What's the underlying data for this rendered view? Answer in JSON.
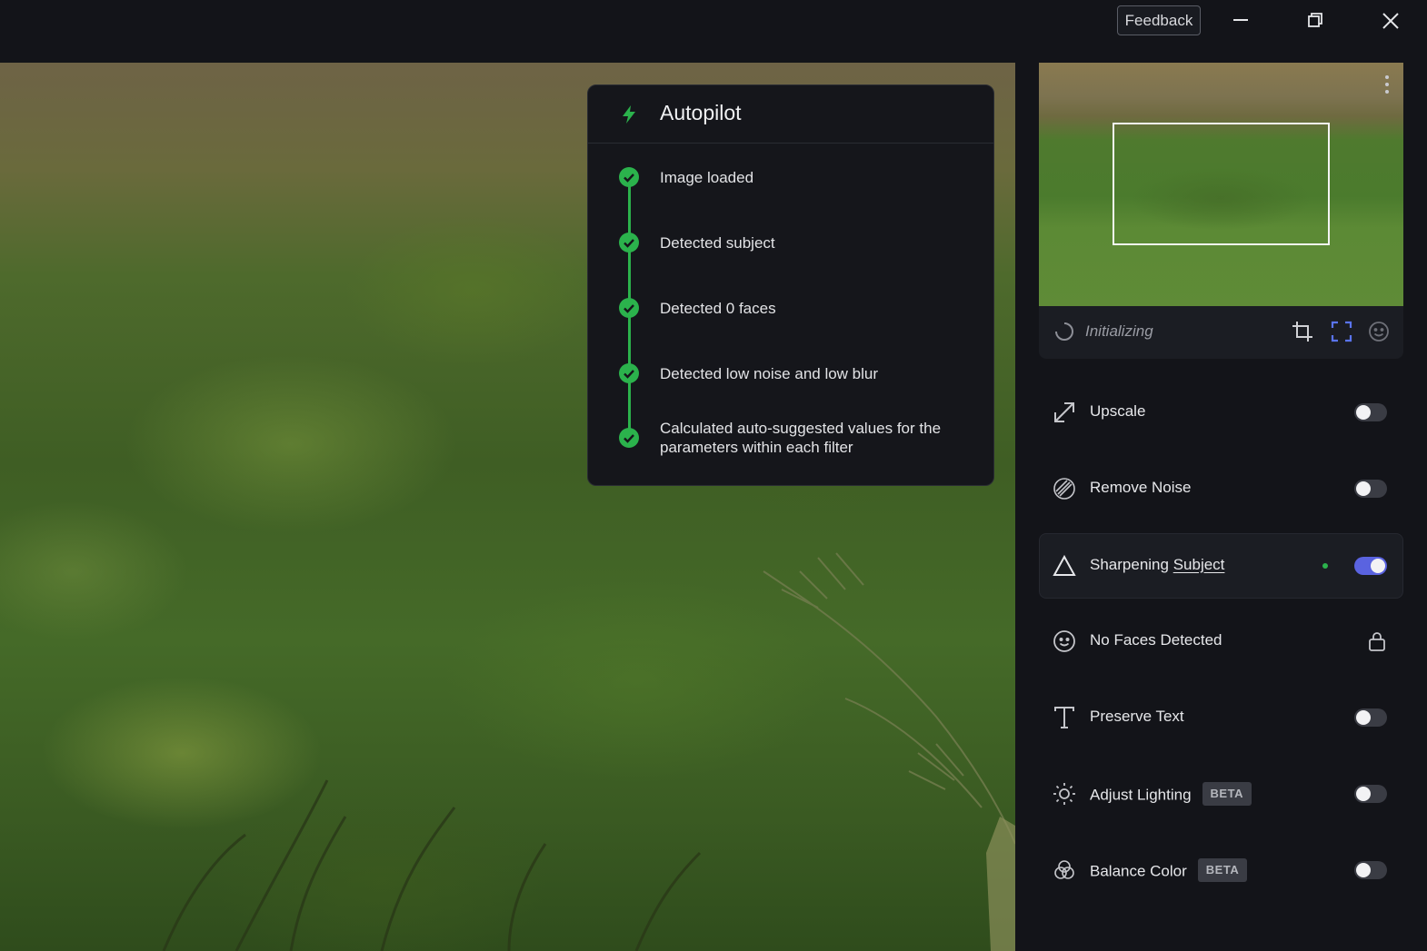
{
  "titlebar": {
    "feedback_label": "Feedback",
    "minimize_icon": "minimize-icon",
    "restore_icon": "restore-icon",
    "close_icon": "close-icon"
  },
  "autopilot": {
    "title": "Autopilot",
    "icon": "lightning-bolt-icon",
    "accent_color": "#2bb24c",
    "steps": [
      {
        "label": "Image loaded",
        "status": "done"
      },
      {
        "label": "Detected subject",
        "status": "done"
      },
      {
        "label": "Detected 0 faces",
        "status": "done"
      },
      {
        "label": "Detected low noise and low blur",
        "status": "done"
      },
      {
        "label": "Calculated auto-suggested values for the parameters within each filter",
        "status": "done"
      }
    ]
  },
  "navigator": {
    "status_text": "Initializing",
    "tools": [
      "crop-icon",
      "fit-to-screen-icon",
      "face-icon"
    ],
    "more_icon": "more-vertical-icon"
  },
  "filters": [
    {
      "label": "Upscale",
      "icon": "upscale-arrow-icon",
      "enabled": false
    },
    {
      "label": "Remove Noise",
      "icon": "remove-noise-icon",
      "enabled": false
    },
    {
      "label": "Sharpening",
      "link_label": "Subject",
      "icon": "triangle-icon",
      "enabled": true,
      "active": true
    },
    {
      "label": "No Faces Detected",
      "icon": "face-icon",
      "locked": true
    },
    {
      "label": "Preserve Text",
      "icon": "text-icon",
      "enabled": false
    },
    {
      "label": "Adjust Lighting",
      "badge": "BETA",
      "icon": "sun-icon",
      "enabled": false
    },
    {
      "label": "Balance Color",
      "badge": "BETA",
      "icon": "color-circles-icon",
      "enabled": false
    }
  ],
  "colors": {
    "background": "#131419",
    "toggle_on": "#5a63e0",
    "success": "#2bb24c"
  }
}
